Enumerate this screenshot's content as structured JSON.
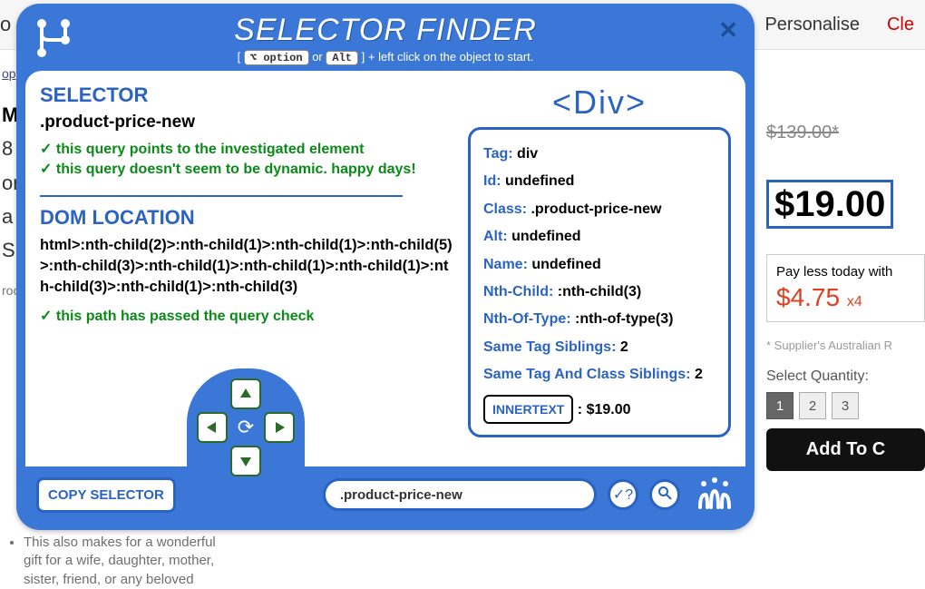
{
  "bg": {
    "header": {
      "personalise": "Personalise",
      "clear": "Cle",
      "left": "o"
    },
    "sidebar": {
      "crumb": "op",
      "lines": [
        "Ma",
        "8",
        "ori",
        "a",
        "Sir",
        "roc"
      ]
    },
    "bullets": [
      "This also makes for a wonderful",
      "gift for a wife, daughter, mother,",
      "sister, friend, or any beloved"
    ],
    "price": {
      "old": "$139.00*",
      "big": "$19.00",
      "payless": "Pay less today with",
      "inst": "$4.75",
      "x4": "x4",
      "supplier": "* Supplier's Australian R",
      "qty_label": "Select Quantity:",
      "qty": [
        "1",
        "2",
        "3"
      ],
      "add": "Add To C"
    }
  },
  "sf": {
    "title": "SELECTOR FINDER",
    "hint": {
      "bracket_open": "[",
      "key1": "⌥ option",
      "or": "or",
      "key2": "Alt",
      "bracket_close": "]",
      "tail": "+ left click on the object to start."
    },
    "left": {
      "h_selector": "SELECTOR",
      "selector_val": ".product-price-new",
      "ok1": "this query points to the investigated element",
      "ok2": "this query doesn't seem to be dynamic. happy days!",
      "h_dom": "DOM LOCATION",
      "dom": "html>:nth-child(2)>:nth-child(1)>:nth-child(1)>:nth-child(5)>:nth-child(3)>:nth-child(1)>:nth-child(1)>:nth-child(1)>:nth-child(3)>:nth-child(1)>:nth-child(3)",
      "ok3": "this path has passed the query check"
    },
    "right": {
      "tagname": "<Div>",
      "rows": [
        {
          "k": "Tag:",
          "v": "div"
        },
        {
          "k": "Id:",
          "v": "undefined"
        },
        {
          "k": "Class:",
          "v": ".product-price-new"
        },
        {
          "k": "Alt:",
          "v": "undefined"
        },
        {
          "k": "Name:",
          "v": "undefined"
        },
        {
          "k": "Nth-Child:",
          "v": ":nth-child(3)"
        },
        {
          "k": "Nth-Of-Type:",
          "v": ":nth-of-type(3)"
        },
        {
          "k": "Same Tag Siblings:",
          "v": "2"
        },
        {
          "k": "Same Tag And Class Siblings:",
          "v": "2"
        }
      ],
      "inner_label": "INNERTEXT",
      "inner_sep": " : ",
      "inner_val": "$19.00"
    },
    "foot": {
      "copy": "COPY SELECTOR",
      "input_val": ".product-price-new",
      "check": "✓?",
      "search": "🔍"
    }
  }
}
